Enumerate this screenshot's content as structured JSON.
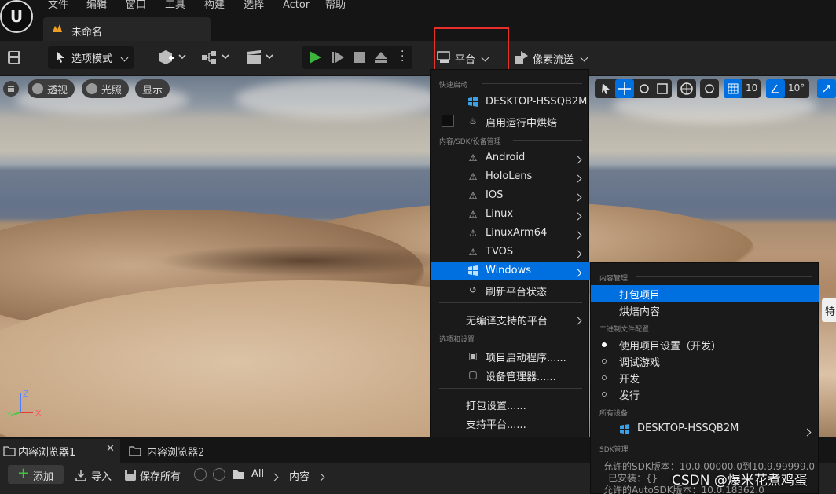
{
  "menubar": {
    "logo": "U",
    "items": [
      "文件",
      "编辑",
      "窗口",
      "工具",
      "构建",
      "选择",
      "Actor",
      "帮助"
    ]
  },
  "doc_tab": {
    "title": "未命名"
  },
  "toolbar": {
    "mode_label": "选项模式",
    "platform_label": "平台",
    "pixel_stream_label": "像素流送"
  },
  "viewport_buttons": {
    "perspective": "透视",
    "lighting": "光照",
    "show": "显示",
    "grid_snap": "10",
    "rotate_snap": "10°"
  },
  "axes": {
    "x": "X",
    "y": "Y",
    "z": "Z"
  },
  "platform_menu": {
    "quick_launch_header": "快速启动",
    "quick_launch_item": "DESKTOP-HSSQB2M",
    "bake_item": "启用运行中烘焙",
    "content_header": "内容/SDK/设备管理",
    "platforms": [
      "Android",
      "HoloLens",
      "IOS",
      "Linux",
      "LinuxArm64",
      "TVOS",
      "Windows"
    ],
    "refresh": "刷新平台状态",
    "no_compile": "无编译支持的平台",
    "options_header": "选项和设置",
    "launcher": "项目启动程序......",
    "device_manager": "设备管理器......",
    "package_settings": "打包设置......",
    "supported_platforms": "支持平台......"
  },
  "windows_submenu": {
    "content_header": "内容管理",
    "package_project": "打包项目",
    "cook_content": "烘焙内容",
    "binary_header": "二进制文件配置",
    "use_project_settings": "使用项目设置（开发）",
    "debug_game": "调试游戏",
    "development": "开发",
    "shipping": "发行",
    "devices_header": "所有设备",
    "device": "DESKTOP-HSSQB2M",
    "sdk_header": "SDK管理",
    "sdk_allowed": "允许的SDK版本：10.0.00000.0到10.9.99999.0",
    "sdk_installed": "已安装：{}",
    "autosdk": "允许的AutoSDK版本：10.0.18362.0"
  },
  "bottom_tabs": [
    "内容浏览器1",
    "内容浏览器2"
  ],
  "bottom_bar": {
    "add": "添加",
    "import": "导入",
    "save_all": "保存所有",
    "path_all": "All",
    "path_content": "内容"
  },
  "watermark": "CSDN @爆米花煮鸡蛋",
  "edge_text": "特"
}
